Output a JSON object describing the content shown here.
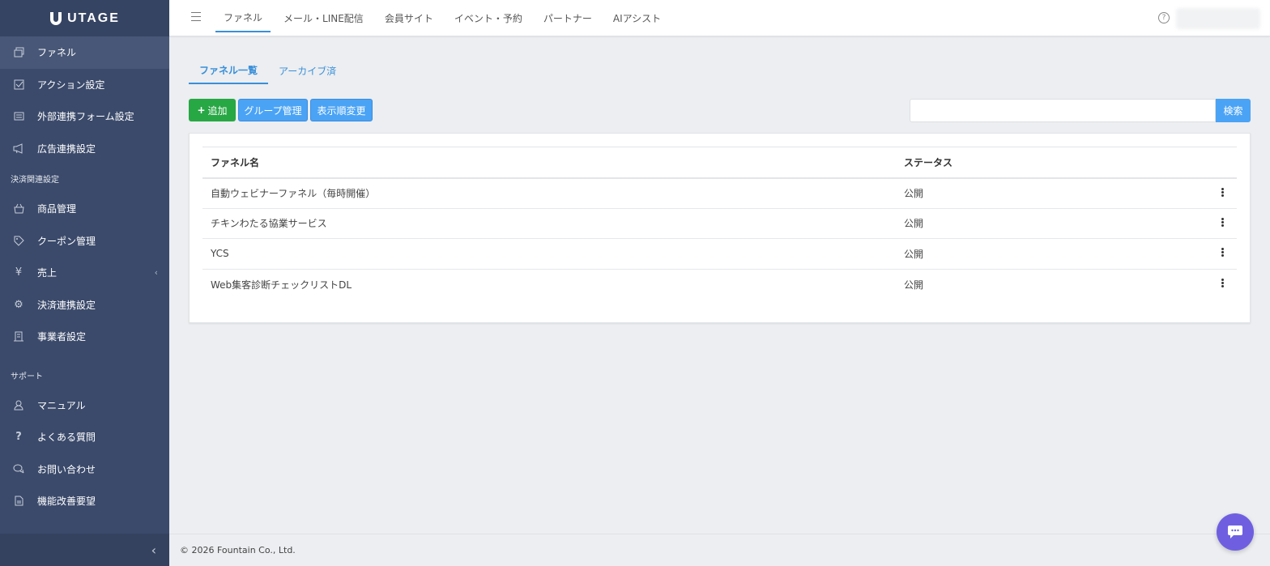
{
  "brand": {
    "name": "UTAGE"
  },
  "sidebar": {
    "items": [
      {
        "label": "ファネル",
        "icon": "funnel-icon",
        "active": true
      },
      {
        "label": "アクション設定",
        "icon": "checkbox-icon"
      },
      {
        "label": "外部連携フォーム設定",
        "icon": "form-icon"
      },
      {
        "label": "広告連携設定",
        "icon": "megaphone-icon"
      }
    ],
    "payment_heading": "決済関連設定",
    "payment_items": [
      {
        "label": "商品管理",
        "icon": "basket-icon"
      },
      {
        "label": "クーポン管理",
        "icon": "tag-icon"
      },
      {
        "label": "売上",
        "icon": "yen-icon",
        "expandable": true
      },
      {
        "label": "決済連携設定",
        "icon": "gear-icon"
      },
      {
        "label": "事業者設定",
        "icon": "building-icon"
      }
    ],
    "support_heading": "サポート",
    "support_items": [
      {
        "label": "マニュアル",
        "icon": "user-icon"
      },
      {
        "label": "よくある質問",
        "icon": "question-icon"
      },
      {
        "label": "お問い合わせ",
        "icon": "chat-icon"
      },
      {
        "label": "機能改善要望",
        "icon": "document-icon"
      }
    ]
  },
  "topnav": {
    "items": [
      "ファネル",
      "メール・LINE配信",
      "会員サイト",
      "イベント・予約",
      "パートナー",
      "AIアシスト"
    ],
    "active_index": 0
  },
  "tabs": {
    "list": "ファネル一覧",
    "archived": "アーカイブ済"
  },
  "toolbar": {
    "add_label": "追加",
    "group_label": "グループ管理",
    "order_label": "表示順変更",
    "search_label": "検索",
    "search_value": ""
  },
  "table": {
    "headers": {
      "name": "ファネル名",
      "status": "ステータス"
    },
    "rows": [
      {
        "name": "自動ウェビナーファネル（毎時開催）",
        "status": "公開"
      },
      {
        "name": "チキンわたる協業サービス",
        "status": "公開"
      },
      {
        "name": "YCS",
        "status": "公開"
      },
      {
        "name": "Web集客診断チェックリストDL",
        "status": "公開"
      }
    ]
  },
  "footer": {
    "copyright": "© 2026 Fountain Co., Ltd."
  },
  "colors": {
    "sidebar": "#3b4a6b",
    "accent": "#3a8fd9",
    "add_button": "#28a745",
    "chat_button": "#6f5fe0"
  }
}
